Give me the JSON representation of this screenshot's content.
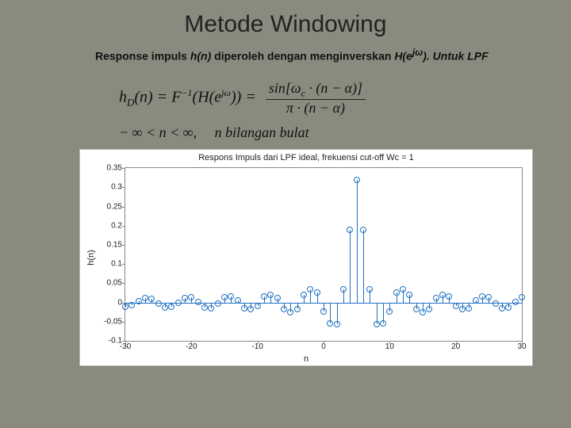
{
  "title": "Metode Windowing",
  "body_prefix": "Response impuls ",
  "body_hn": "h(n)",
  "body_mid": " diperoleh dengan menginverskan ",
  "body_He": "H(e",
  "body_exp": "jω",
  "body_suffix": "). Untuk LPF",
  "eq": {
    "lhs": "h",
    "sub": "D",
    "n": "(n) = F",
    "inv": "−1",
    "arg": "(H(e",
    "argexp": "jω",
    "argend": ")) =",
    "num": "sin[ω",
    "numc": "c",
    "numrest": " · (n − α)]",
    "den": "π · (n − α)",
    "row2a": "− ∞ < n < ∞,",
    "row2b": "n bilangan  bulat"
  },
  "chart_data": {
    "type": "stem",
    "title": "Respons Impuls dari LPF ideal, frekuensi cut-off Wc = 1",
    "xlabel": "n",
    "ylabel": "h(n)",
    "xlim": [
      -30,
      30
    ],
    "ylim": [
      -0.1,
      0.35
    ],
    "xticks": [
      -30,
      -20,
      -10,
      0,
      10,
      20,
      30
    ],
    "yticks": [
      -0.1,
      -0.05,
      0,
      0.05,
      0.1,
      0.15,
      0.2,
      0.25,
      0.3,
      0.35
    ],
    "x": [
      -30,
      -29,
      -28,
      -27,
      -26,
      -25,
      -24,
      -23,
      -22,
      -21,
      -20,
      -19,
      -18,
      -17,
      -16,
      -15,
      -14,
      -13,
      -12,
      -11,
      -10,
      -9,
      -8,
      -7,
      -6,
      -5,
      -4,
      -3,
      -2,
      -1,
      0,
      1,
      2,
      3,
      4,
      5,
      6,
      7,
      8,
      9,
      10,
      11,
      12,
      13,
      14,
      15,
      16,
      17,
      18,
      19,
      20,
      21,
      22,
      23,
      24,
      25,
      26,
      27,
      28,
      29,
      30
    ],
    "y": [
      -0.0105,
      -0.0073,
      0.0031,
      0.0113,
      0.0102,
      -0.0017,
      -0.0121,
      -0.0117,
      0.0,
      0.0127,
      0.013,
      0.0016,
      -0.0134,
      -0.0143,
      -0.0034,
      0.0142,
      0.0159,
      0.0056,
      -0.0151,
      -0.018,
      -0.0083,
      0.0163,
      0.021,
      0.0119,
      -0.0179,
      -0.0255,
      -0.0172,
      0.0201,
      0.0336,
      0.0268,
      -0.0239,
      -0.0537,
      -0.0555,
      0.0337,
      0.1892,
      0.3183,
      0.1892,
      0.0337,
      -0.0555,
      -0.0537,
      -0.0239,
      0.0268,
      0.0336,
      0.0201,
      -0.0172,
      -0.0255,
      -0.0179,
      0.0119,
      0.021,
      0.0163,
      -0.0083,
      -0.018,
      -0.0151,
      0.0056,
      0.0159,
      0.0142,
      -0.0034,
      -0.0143,
      -0.0134,
      0.0016,
      0.013
    ]
  }
}
